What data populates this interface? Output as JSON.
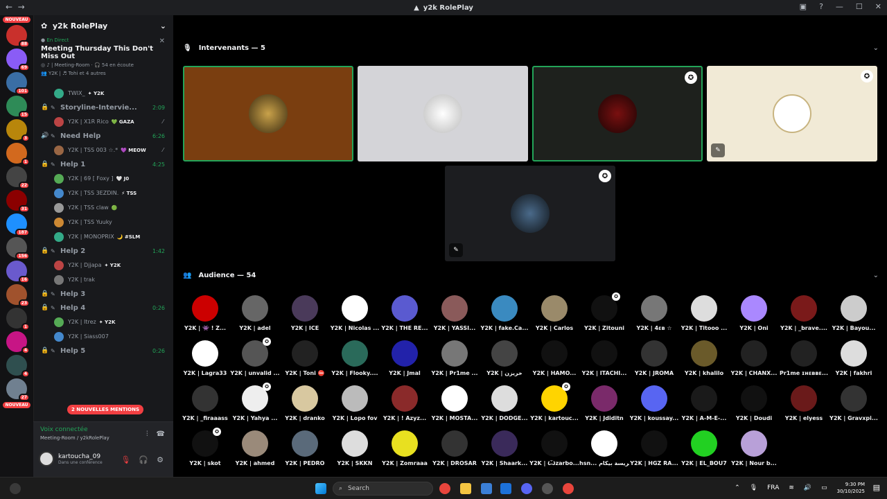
{
  "window": {
    "title": "y2k RolePlay"
  },
  "servers": {
    "badges": [
      "88",
      "69",
      "101",
      "15",
      "3",
      "1",
      "22",
      "31",
      "187",
      "156",
      "16",
      "23",
      "1",
      "4",
      "4",
      "27"
    ],
    "nouveau": "NOUVEAU"
  },
  "guild": {
    "name": "y2k RolePlay"
  },
  "live": {
    "tag": "En Direct",
    "title": "Meeting Thursday This Don't Miss Out",
    "room": "Meeting-Room",
    "listening": "54 en écoute",
    "speakers": "Y2K | ♬ Tohi et 4 autres"
  },
  "channel_list": [
    {
      "kind": "member",
      "name": "TWIX_",
      "tag": "✦ Y2K"
    },
    {
      "kind": "channel",
      "name": "Storyline-Intervie...",
      "time": "2:09",
      "icon": "stage"
    },
    {
      "kind": "member",
      "name": "Y2K | X1R Rico",
      "tag": "💚 GAZA",
      "muted": true
    },
    {
      "kind": "channel",
      "name": "Need Help",
      "time": "6:26",
      "icon": "speaker"
    },
    {
      "kind": "member",
      "name": "Y2K | TSS 003 ☆.*",
      "tag": "💜 MEOW",
      "muted": true
    },
    {
      "kind": "channel",
      "name": "Help 1",
      "time": "4:25",
      "icon": "lock"
    },
    {
      "kind": "member",
      "name": "Y2K | 69 [ Foxy ]",
      "tag": "🤍 J0"
    },
    {
      "kind": "member",
      "name": "Y2K | TSS 3EZDIN.",
      "tag": "⚡ TSS"
    },
    {
      "kind": "member",
      "name": "Y2K | TSS claw",
      "tag": "🟢"
    },
    {
      "kind": "member",
      "name": "Y2K | TSS Yuuky",
      "tag": ""
    },
    {
      "kind": "member",
      "name": "Y2K | MONOPRIX",
      "tag": "🌙 #SLM"
    },
    {
      "kind": "channel",
      "name": "Help 2",
      "time": "1:42",
      "icon": "lock"
    },
    {
      "kind": "member",
      "name": "Y2K | Djjapa",
      "tag": "✦ Y2K"
    },
    {
      "kind": "member",
      "name": "Y2K | trak",
      "tag": ""
    },
    {
      "kind": "channel",
      "name": "Help 3",
      "time": "",
      "icon": "lock"
    },
    {
      "kind": "channel",
      "name": "Help 4",
      "time": "0:26",
      "icon": "lock"
    },
    {
      "kind": "member",
      "name": "Y2K | Itrez",
      "tag": "✦ Y2K"
    },
    {
      "kind": "member",
      "name": "Y2K | Siass007",
      "tag": ""
    },
    {
      "kind": "channel",
      "name": "Help 5",
      "time": "0:26",
      "icon": "lock"
    }
  ],
  "mentions": "2 NOUVELLES MENTIONS",
  "voice": {
    "status": "Voix connectée",
    "room": "Meeting-Room / y2kRolePlay"
  },
  "user": {
    "name": "kartoucha_09",
    "status": "Dans une conférence"
  },
  "speakers": {
    "label": "Intervenants — 5"
  },
  "audience": {
    "label": "Audience — 54",
    "members": [
      "Y2K | 👾 ! Z...",
      "Y2K | adel",
      "Y2K | ICE",
      "Y2K | Nicolas ...",
      "Y2K | THE RE...",
      "Y2K | YASSI...",
      "Y2K | fake.Ca...",
      "Y2K | Carlos",
      "Y2K | Zitouni",
      "Y2K | 4ᴇв ☆",
      "Y2K | Titooo ...",
      "Y2K | Oni",
      "Y2K | _brave....",
      "Y2K | Bayou...",
      "Y2K | Lagra33",
      "Y2K | unvalid ...",
      "Y2K | Toni ⛔",
      "Y2K | Flooky....",
      "Y2K | Jmal",
      "Y2K | Pr1me ...",
      "Y2K | خريزن",
      "Y2K | HAMO...",
      "Y2K | ITACHI...",
      "Y2K | JROMA",
      "Y2K | khalilo",
      "Y2K | CHANX...",
      "Pr1me ɪʜᴇʙʙᴇ...",
      "Y2K | fakhri",
      "Y2K | _firaaass",
      "Y2K | Yahya ...",
      "Y2K | dranko",
      "Y2K | Lopo fov",
      "Y2K | ! Azyz...",
      "Y2K | MOSTA...",
      "Y2K | DODGE...",
      "Y2K | kartouc...",
      "Y2K | Jdiditn",
      "Y2K | koussay...",
      "Y2K | A-M-E-...",
      "Y2K | Doudi",
      "Y2K | elyess",
      "Y2K | Gravxpi...",
      "Y2K | skot",
      "Y2K | ahmed",
      "Y2K | PEDRO",
      "Y2K | SKKN",
      "Y2K | Zomraaa",
      "Y2K | DROSAR",
      "Y2K | Shaark...",
      "Y2K | Ѽzarbo...",
      "hsn... هريسة بيكام",
      "Y2K | HGZ RA...",
      "Y2K | EL_BOU7",
      "Y2K | Nour b..."
    ]
  },
  "taskbar": {
    "search": "Search",
    "lang": "FRA",
    "time": "9:30 PM",
    "date": "30/10/2025"
  },
  "colors": {
    "accent": "#23a559",
    "danger": "#f23f42",
    "bg": "#000000"
  }
}
